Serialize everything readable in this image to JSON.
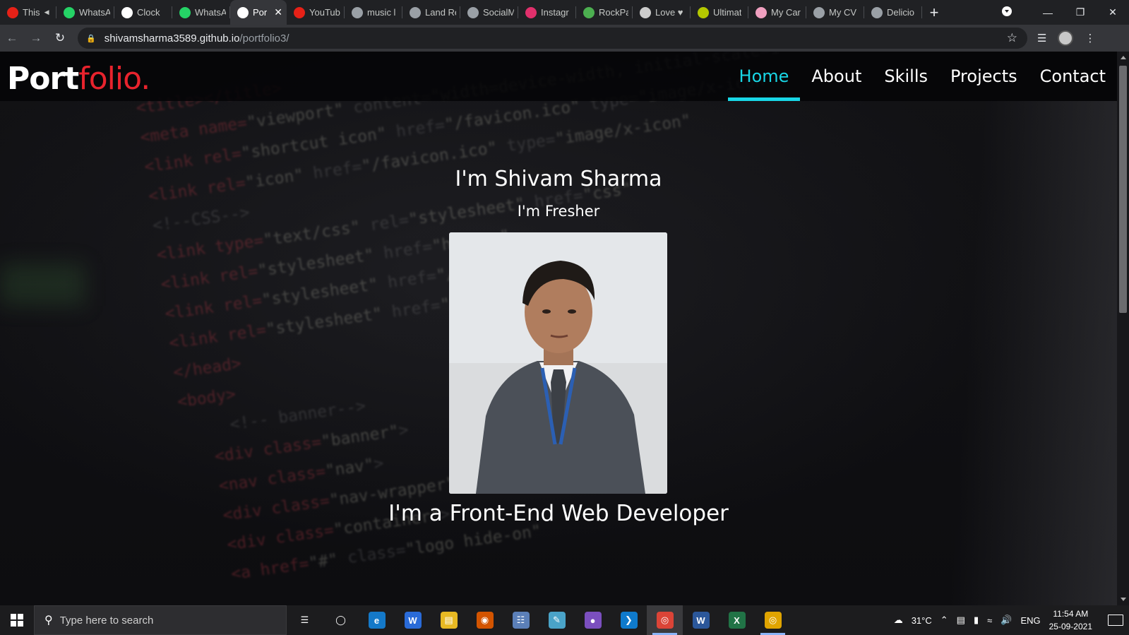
{
  "browser": {
    "tabs": [
      {
        "label": "This",
        "favicon": "youtube-icon",
        "color": "#e62117",
        "audio": true
      },
      {
        "label": "WhatsA",
        "favicon": "whatsapp-icon",
        "color": "#25d366"
      },
      {
        "label": "Clock",
        "favicon": "clock-icon",
        "color": "#ffffff"
      },
      {
        "label": "WhatsA",
        "favicon": "whatsapp-icon",
        "color": "#25d366"
      },
      {
        "label": "Por",
        "favicon": "portfolio-icon",
        "color": "#ffffff",
        "active": true
      },
      {
        "label": "YouTub",
        "favicon": "youtube-icon",
        "color": "#e62117"
      },
      {
        "label": "music l",
        "favicon": "globe-icon",
        "color": "#9aa0a6"
      },
      {
        "label": "Land Re",
        "favicon": "globe-icon",
        "color": "#9aa0a6"
      },
      {
        "label": "SocialM",
        "favicon": "globe-icon",
        "color": "#9aa0a6"
      },
      {
        "label": "Instagr",
        "favicon": "instagram-icon",
        "color": "#e1306c"
      },
      {
        "label": "RockPa",
        "favicon": "rockpaper-icon",
        "color": "#4caf50"
      },
      {
        "label": "Love ♥",
        "favicon": "love-icon",
        "color": "#cccccc"
      },
      {
        "label": "Ultimat",
        "favicon": "ultimate-icon",
        "color": "#b4c800"
      },
      {
        "label": "My Car",
        "favicon": "mycar-icon",
        "color": "#f0a0c0"
      },
      {
        "label": "My CV",
        "favicon": "globe-icon",
        "color": "#9aa0a6"
      },
      {
        "label": "Delicio",
        "favicon": "globe-icon",
        "color": "#9aa0a6"
      }
    ],
    "url_host": "shivamsharma3589.github.io",
    "url_path": "/portfolio3/"
  },
  "site": {
    "logo_main": "Port",
    "logo_accent": "folio.",
    "nav": [
      {
        "label": "Home",
        "active": true
      },
      {
        "label": "About"
      },
      {
        "label": "Skills"
      },
      {
        "label": "Projects"
      },
      {
        "label": "Contact"
      }
    ],
    "hero": {
      "name": "I'm Shivam Sharma",
      "subtitle": "I'm Fresher",
      "tagline": "I'm a Front-End Web Developer"
    },
    "accent_color": "#18d6e6",
    "logo_accent_color": "#e8232d"
  },
  "taskbar": {
    "search_placeholder": "Type here to search",
    "apps": [
      "task-view-icon",
      "cortana-icon",
      "edge-icon",
      "wps-icon",
      "file-explorer-icon",
      "music-player-icon",
      "calculator-icon",
      "notes-icon",
      "github-desktop-icon",
      "vscode-icon",
      "chrome-icon",
      "word-icon",
      "excel-icon",
      "chrome-canary-icon"
    ],
    "weather": "31°C",
    "language": "ENG",
    "time": "11:54 AM",
    "date": "25-09-2021"
  }
}
